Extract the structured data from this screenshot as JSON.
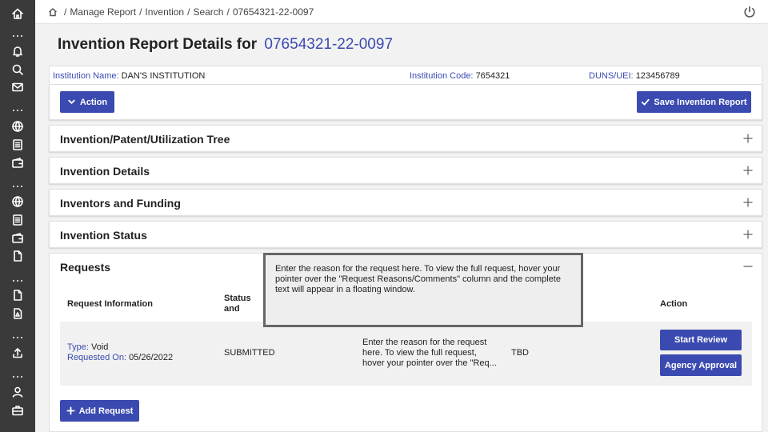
{
  "breadcrumb": {
    "items": [
      "Manage Report",
      "Invention",
      "Search",
      "07654321-22-0097"
    ]
  },
  "page": {
    "title_prefix": "Invention Report Details for",
    "title_number": "07654321-22-0097"
  },
  "institution": {
    "name_label": "Institution Name:",
    "name_value": "DAN'S INSTITUTION",
    "code_label": "Institution Code:",
    "code_value": "7654321",
    "duns_label": "DUNS/UEI:",
    "duns_value": "123456789"
  },
  "toolbar": {
    "action_label": "Action",
    "save_label": "Save Invention Report"
  },
  "panels": [
    {
      "title": "Invention/Patent/Utilization Tree"
    },
    {
      "title": "Invention Details"
    },
    {
      "title": "Inventors and Funding"
    },
    {
      "title": "Invention Status"
    }
  ],
  "requests": {
    "title": "Requests",
    "columns": {
      "info": "Request Information",
      "status": "Status and Document",
      "action": "Action"
    },
    "row": {
      "type_label": "Type:",
      "type_value": "Void",
      "requested_label": "Requested On:",
      "requested_value": "05/26/2022",
      "status": "SUBMITTED",
      "reason": "Enter the reason for the request here. To view the full request, hover your pointer over the \"Req...",
      "tbd": "TBD",
      "start_review": "Start Review",
      "agency_approval": "Agency Approval"
    },
    "add_label": "Add Request"
  },
  "tooltip": {
    "text": "Enter the reason for the request here. To view the full request, hover your pointer over the \"Request Reasons/Comments\" column and the complete text will appear in a floating window."
  },
  "colors": {
    "accent": "#3a4ab0",
    "sidebar": "#3a3a3a"
  }
}
